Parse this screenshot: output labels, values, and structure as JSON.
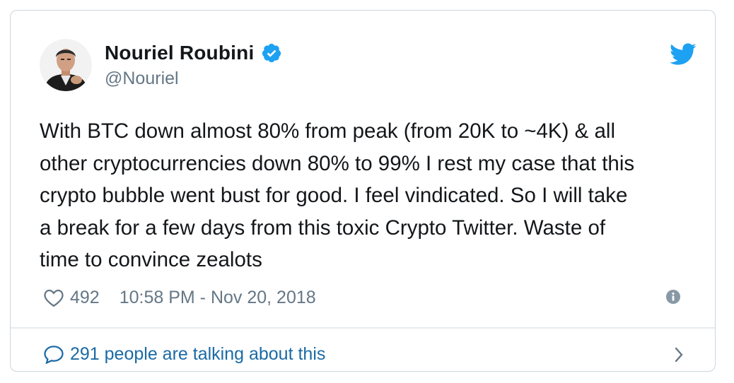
{
  "user": {
    "display_name": "Nouriel Roubini",
    "handle": "@Nouriel",
    "verified": true
  },
  "tweet": {
    "text": "With BTC down almost 80% from peak (from 20K to ~4K) & all\nother cryptocurrencies down 80% to 99% I rest my case that this\ncrypto bubble went bust for good. I feel vindicated. So I will take\na break for a few days from this toxic Crypto Twitter. Waste of\ntime to convince zealots",
    "likes": "492",
    "timestamp": "10:58 PM - Nov 20, 2018"
  },
  "footer": {
    "talking_text": "291 people are talking about this"
  },
  "icons": {
    "verified": "verified-badge-icon",
    "bird": "twitter-bird-icon",
    "heart": "heart-icon",
    "info": "info-icon",
    "bubble": "speech-bubble-icon",
    "chevron": "chevron-right-icon"
  },
  "colors": {
    "twitter_blue": "#1da1f2",
    "link_blue": "#1b6aa5",
    "text": "#14171a",
    "muted": "#657786",
    "border": "#ccd6dd"
  }
}
